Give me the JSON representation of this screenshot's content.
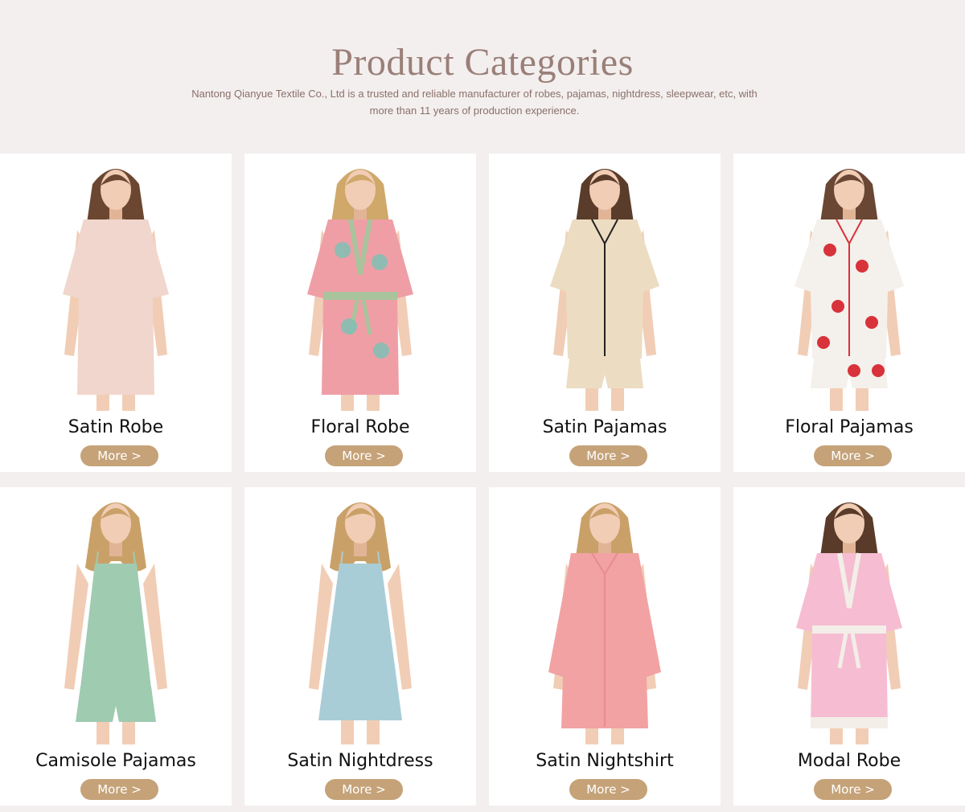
{
  "header": {
    "title": "Product Categories",
    "intro_line1": "Nantong Qianyue Textile Co., Ltd is a trusted and reliable manufacturer of robes, pajamas, nightdress, sleepwear, etc, with",
    "intro_line2": "more than 11 years of production experience."
  },
  "more_label": "More >",
  "categories": [
    {
      "name": "Satin Robe",
      "garment": "robe",
      "color": "#f0d6cc",
      "trim": "#f0d6cc",
      "hair": "#6b4630",
      "pattern": "none"
    },
    {
      "name": "Floral Robe",
      "garment": "robe",
      "color": "#ef9ea6",
      "trim": "#a9c49c",
      "hair": "#cfa86a",
      "pattern": "floral-teal"
    },
    {
      "name": "Satin Pajamas",
      "garment": "pajamas",
      "color": "#ecdcc2",
      "trim": "#222222",
      "hair": "#5a3c2a",
      "pattern": "none"
    },
    {
      "name": "Floral Pajamas",
      "garment": "pajamas",
      "color": "#f4f0ec",
      "trim": "#d8323a",
      "hair": "#6a4634",
      "pattern": "floral-red"
    },
    {
      "name": "Camisole Pajamas",
      "garment": "camisole",
      "color": "#9fcbb0",
      "trim": "#9fcbb0",
      "hair": "#c9a168",
      "pattern": "none"
    },
    {
      "name": "Satin Nightdress",
      "garment": "nightdress",
      "color": "#a9cdd6",
      "trim": "#a9cdd6",
      "hair": "#c9a168",
      "pattern": "none"
    },
    {
      "name": "Satin Nightshirt",
      "garment": "nightshirt",
      "color": "#f2a2a3",
      "trim": "#f2a2a3",
      "hair": "#c9a168",
      "pattern": "none"
    },
    {
      "name": "Modal Robe",
      "garment": "robe",
      "color": "#f6bcd2",
      "trim": "#f3eee8",
      "hair": "#5a3a28",
      "pattern": "lace"
    }
  ]
}
